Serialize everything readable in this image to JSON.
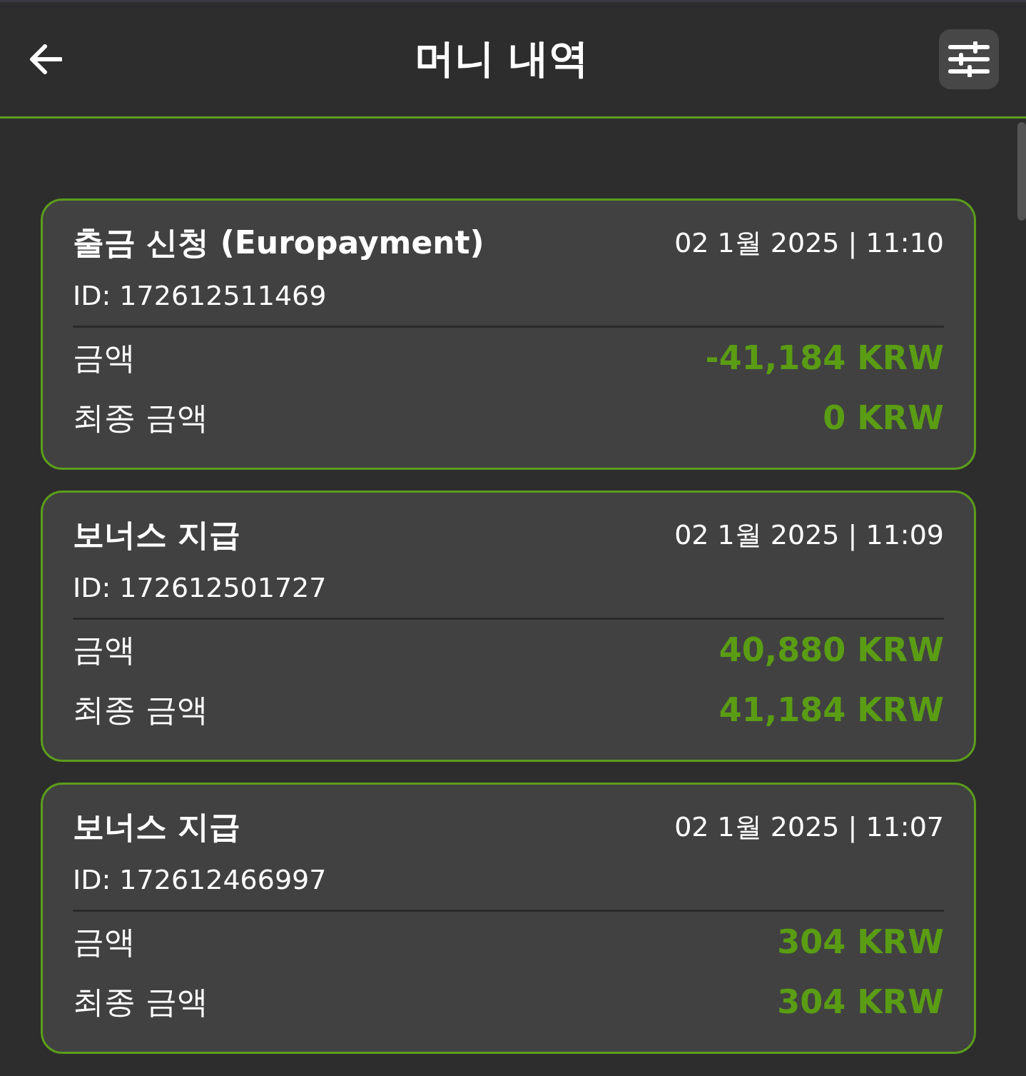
{
  "header": {
    "title": "머니 내역"
  },
  "transactions": [
    {
      "title": "출금 신청 (Europayment)",
      "date": "02 1월 2025 | 11:10",
      "id": "ID: 172612511469",
      "rows": [
        {
          "label": "금액",
          "value": "-41,184 KRW"
        },
        {
          "label": "최종 금액",
          "value": "0 KRW"
        }
      ]
    },
    {
      "title": "보너스 지급",
      "date": "02 1월 2025 | 11:09",
      "id": "ID: 172612501727",
      "rows": [
        {
          "label": "금액",
          "value": "40,880 KRW"
        },
        {
          "label": "최종 금액",
          "value": "41,184 KRW"
        }
      ]
    },
    {
      "title": "보너스 지급",
      "date": "02 1월 2025 | 11:07",
      "id": "ID: 172612466997",
      "rows": [
        {
          "label": "금액",
          "value": "304 KRW"
        },
        {
          "label": "최종 금액",
          "value": "304 KRW"
        }
      ]
    }
  ]
}
